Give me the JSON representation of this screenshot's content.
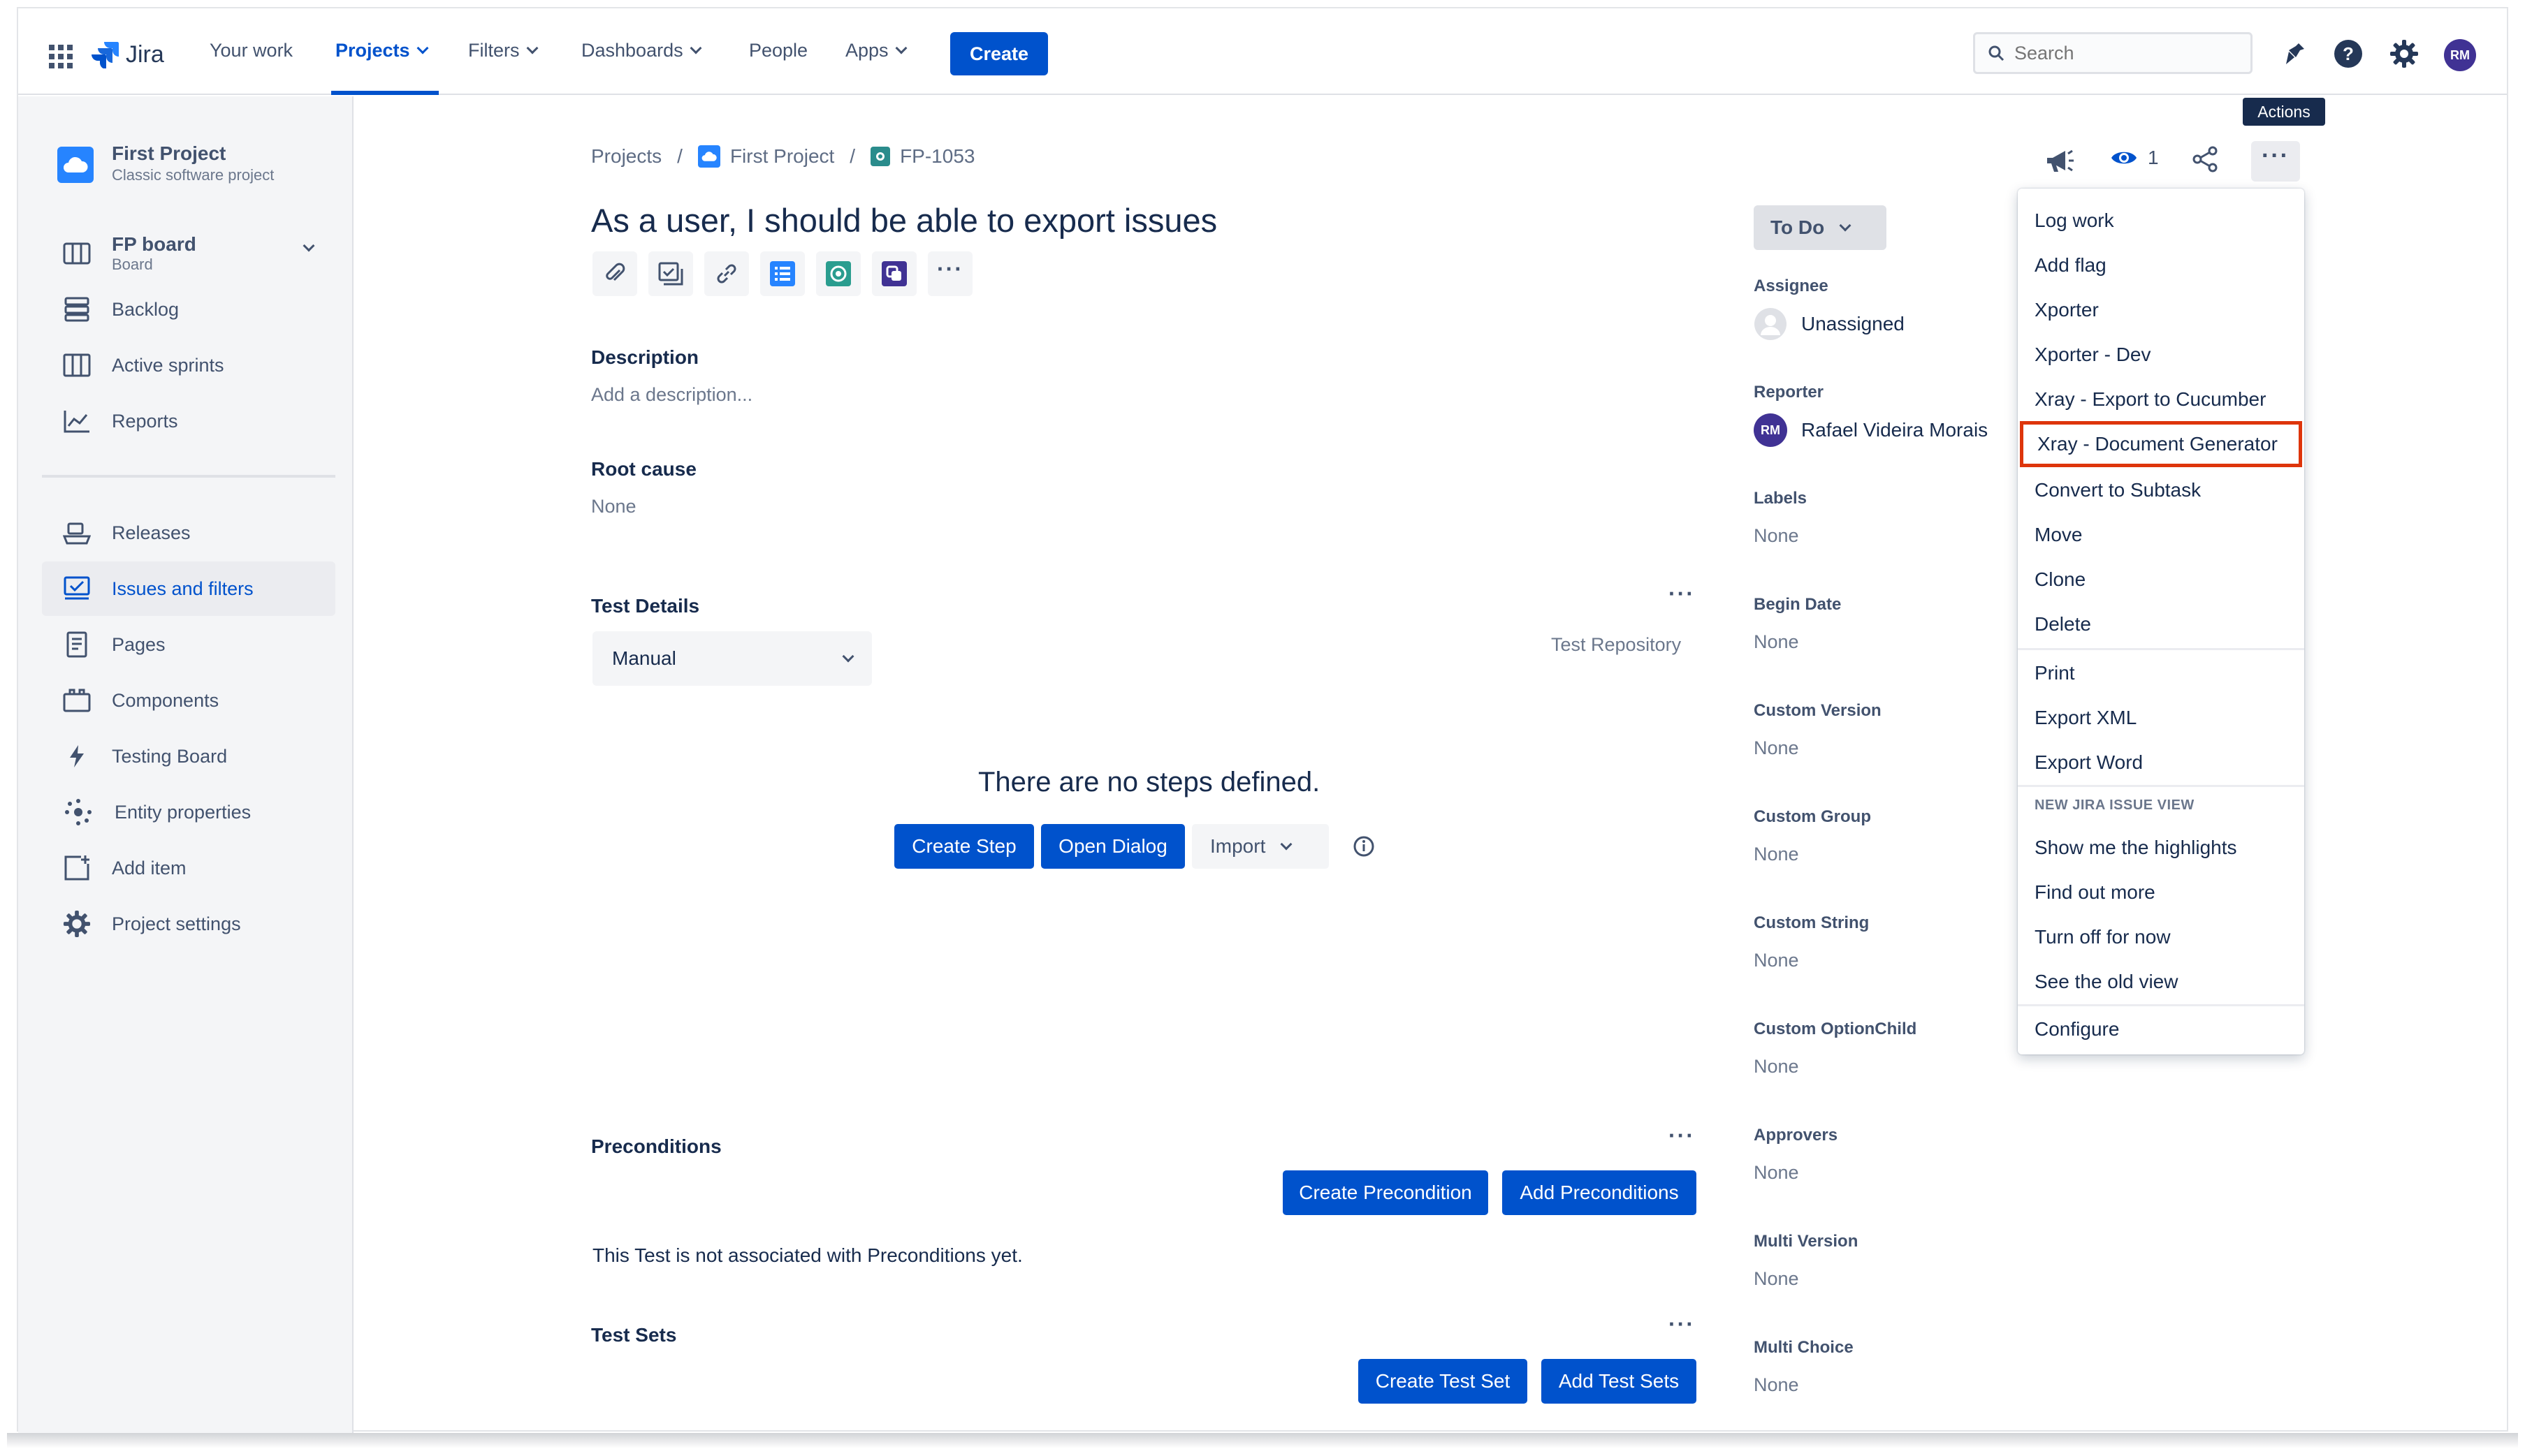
{
  "colors": {
    "brand": "#0052cc",
    "highlight": "#de350b",
    "avatar": "#403294"
  },
  "topnav": {
    "logo_text": "Jira",
    "items": [
      "Your work",
      "Projects",
      "Filters",
      "Dashboards",
      "People",
      "Apps"
    ],
    "create_label": "Create",
    "search_placeholder": "Search",
    "avatar_initials": "RM",
    "icons": [
      "app-switcher-icon",
      "notifications-icon",
      "help-icon",
      "settings-icon"
    ]
  },
  "sidebar": {
    "project_name": "First Project",
    "project_type": "Classic software project",
    "board_name": "FP board",
    "board_sub": "Board",
    "items": [
      {
        "label": "Backlog",
        "icon": "backlog-icon"
      },
      {
        "label": "Active sprints",
        "icon": "sprints-icon"
      },
      {
        "label": "Reports",
        "icon": "reports-icon"
      },
      {
        "label": "Releases",
        "icon": "releases-icon"
      },
      {
        "label": "Issues and filters",
        "icon": "issues-icon"
      },
      {
        "label": "Pages",
        "icon": "pages-icon"
      },
      {
        "label": "Components",
        "icon": "components-icon"
      },
      {
        "label": "Testing Board",
        "icon": "testing-board-icon"
      },
      {
        "label": "Entity properties",
        "icon": "entity-icon"
      },
      {
        "label": "Add item",
        "icon": "add-item-icon"
      },
      {
        "label": "Project settings",
        "icon": "gear-icon"
      }
    ],
    "selected": "Issues and filters"
  },
  "breadcrumb": {
    "projects": "Projects",
    "sep": "/",
    "project": "First Project",
    "issue_key": "FP-1053"
  },
  "issue": {
    "title": "As a user, I should be able to export issues",
    "description_label": "Description",
    "description_placeholder": "Add a description...",
    "root_cause_label": "Root cause",
    "root_cause_value": "None"
  },
  "test_details": {
    "label": "Test Details",
    "type": "Manual",
    "repository_link": "Test Repository",
    "empty_message": "There are no steps defined.",
    "create_step": "Create Step",
    "open_dialog": "Open Dialog",
    "import": "Import"
  },
  "preconditions": {
    "label": "Preconditions",
    "create": "Create Precondition",
    "add": "Add Preconditions",
    "empty_message": "This Test is not associated with Preconditions yet."
  },
  "test_sets": {
    "label": "Test Sets",
    "create": "Create Test Set",
    "add": "Add Test Sets"
  },
  "details": {
    "status": "To Do",
    "assignee_label": "Assignee",
    "assignee": "Unassigned",
    "reporter_label": "Reporter",
    "reporter": "Rafael Videira Morais",
    "reporter_initials": "RM",
    "fields": [
      {
        "label": "Labels",
        "value": "None"
      },
      {
        "label": "Begin Date",
        "value": "None"
      },
      {
        "label": "Custom Version",
        "value": "None"
      },
      {
        "label": "Custom Group",
        "value": "None"
      },
      {
        "label": "Custom String",
        "value": "None"
      },
      {
        "label": "Custom OptionChild",
        "value": "None"
      },
      {
        "label": "Approvers",
        "value": "None"
      },
      {
        "label": "Multi Version",
        "value": "None"
      },
      {
        "label": "Multi Choice",
        "value": "None"
      }
    ]
  },
  "header_actions": {
    "watch_count": "1",
    "tooltip": "Actions"
  },
  "menu": {
    "items": [
      "Log work",
      "Add flag",
      "Xporter",
      "Xporter - Dev",
      "Xray - Export to Cucumber",
      "Xray - Document Generator",
      "Convert to Subtask",
      "Move",
      "Clone",
      "Delete"
    ],
    "items2": [
      "Print",
      "Export XML",
      "Export Word"
    ],
    "group_label": "NEW JIRA ISSUE VIEW",
    "items3": [
      "Show me the highlights",
      "Find out more",
      "Turn off for now",
      "See the old view"
    ],
    "items4": [
      "Configure"
    ],
    "highlighted": "Xray - Document Generator"
  }
}
